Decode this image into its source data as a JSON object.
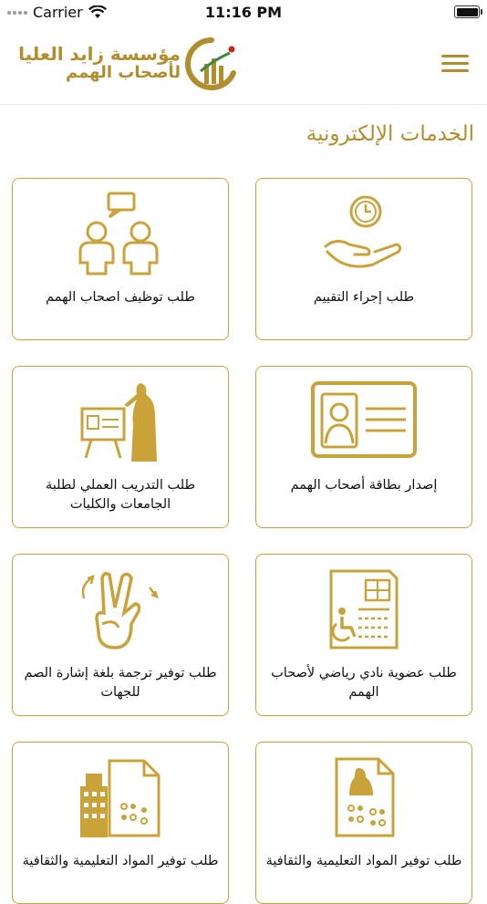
{
  "status_bar": {
    "carrier": "Carrier",
    "time": "11:16 PM",
    "wifi_icon": "wifi-icon",
    "battery_icon": "battery-icon"
  },
  "header": {
    "logo_line1": "مؤسسة زايد العليا",
    "logo_line2": "لأصحاب الهمم",
    "menu_icon": "hamburger-menu-icon",
    "brand_color": "#b08d2d"
  },
  "section_title": "الخدمات الإلكترونية",
  "services": [
    {
      "label": "طلب إجراء التقييم",
      "icon": "hand-clock-icon"
    },
    {
      "label": "طلب توظيف اصحاب الهمم",
      "icon": "people-chat-icon"
    },
    {
      "label": "إصدار بطاقة أصحاب الهمم",
      "icon": "id-card-icon"
    },
    {
      "label": "طلب التدريب العملي لطلبة الجامعات والكليات",
      "icon": "presentation-board-icon"
    },
    {
      "label": "طلب عضوية نادي رياضي لأصحاب الهمم",
      "icon": "wheelchair-document-icon"
    },
    {
      "label": "طلب توفير ترجمة بلغة إشارة الصم للجهات",
      "icon": "sign-language-hand-icon"
    },
    {
      "label": "طلب توفير المواد التعليمية والثقافية",
      "icon": "braille-document-icon"
    },
    {
      "label": "طلب توفير المواد التعليمية والثقافية",
      "icon": "building-braille-icon"
    }
  ],
  "colors": {
    "accent": "#c9a33a",
    "text": "#111111"
  }
}
